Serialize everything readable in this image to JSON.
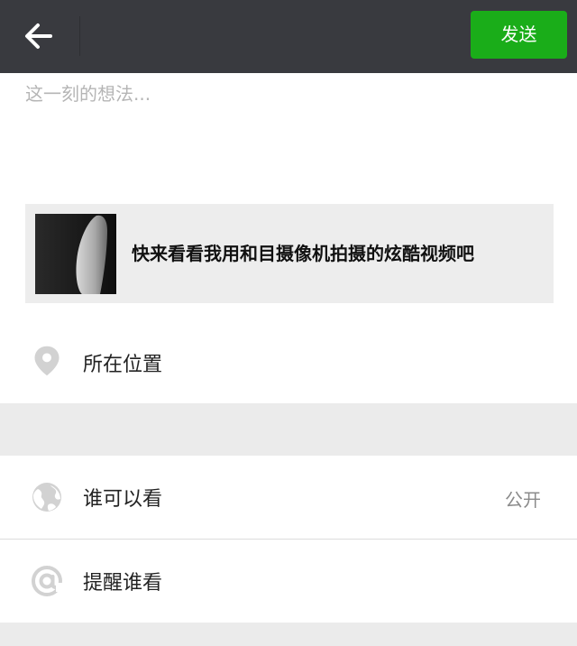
{
  "header": {
    "send_label": "发送"
  },
  "compose": {
    "placeholder": "这一刻的想法..."
  },
  "share": {
    "title": "快来看看我用和目摄像机拍摄的炫酷视频吧"
  },
  "location": {
    "label": "所在位置"
  },
  "visibility": {
    "label": "谁可以看",
    "value": "公开"
  },
  "mention": {
    "label": "提醒谁看"
  },
  "colors": {
    "topbar": "#393a3f",
    "send_button": "#1aad19",
    "separator": "#ebebeb"
  }
}
